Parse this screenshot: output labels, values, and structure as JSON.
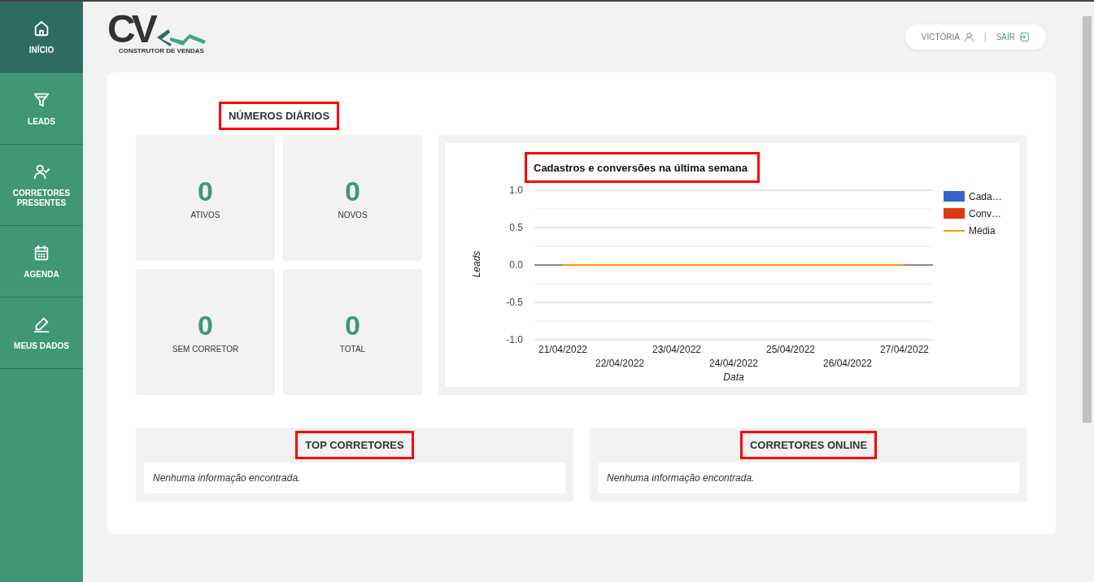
{
  "sidebar": {
    "items": [
      {
        "label": "INÍCIO",
        "selected": true
      },
      {
        "label": "LEADS",
        "selected": false
      },
      {
        "label": "CORRETORES PRESENTES",
        "selected": false
      },
      {
        "label": "AGENDA",
        "selected": false
      },
      {
        "label": "MEUS DADOS",
        "selected": false
      }
    ]
  },
  "header": {
    "logo": {
      "mark": "CV",
      "tagline": "CONSTRUTOR DE VENDAS"
    },
    "user": "VICTÓRIA",
    "separator": "|",
    "logout": "SAIR"
  },
  "daily_numbers": {
    "title": "NÚMEROS DIÁRIOS",
    "framed": true,
    "stats": [
      {
        "value": "0",
        "label": "ATIVOS"
      },
      {
        "value": "0",
        "label": "NOVOS"
      },
      {
        "value": "0",
        "label": "SEM CORRETOR"
      },
      {
        "value": "0",
        "label": "TOTAL"
      }
    ]
  },
  "weekly_chart": {
    "framed": true,
    "chart_data": {
      "type": "bar",
      "title": "Cadastros e conversões na última semana",
      "xlabel": "Data",
      "ylabel": "Leads",
      "categories": [
        "21/04/2022",
        "22/04/2022",
        "23/04/2022",
        "24/04/2022",
        "25/04/2022",
        "26/04/2022",
        "27/04/2022"
      ],
      "ylim": [
        -1,
        1
      ],
      "grid": true,
      "yticks": [
        {
          "value": 1,
          "label": "1.0"
        },
        {
          "value": 0.5,
          "label": "0.5"
        },
        {
          "value": 0,
          "label": "0.0"
        },
        {
          "value": -0.5,
          "label": "-0.5"
        },
        {
          "value": -1,
          "label": "-1.0"
        }
      ],
      "series": [
        {
          "name": "Cada…",
          "color": "#3366cc",
          "type": "bar",
          "values": [
            0,
            0,
            0,
            0,
            0,
            0,
            0
          ]
        },
        {
          "name": "Conv…",
          "color": "#dc3912",
          "type": "bar",
          "values": [
            0,
            0,
            0,
            0,
            0,
            0,
            0
          ]
        },
        {
          "name": "Média",
          "color": "#ff9900",
          "type": "line",
          "values": [
            0,
            0,
            0,
            0,
            0,
            0,
            0
          ]
        }
      ]
    }
  },
  "panels": [
    {
      "title": "TOP CORRETORES",
      "framed": true,
      "message": "Nenhuma informação encontrada."
    },
    {
      "title": "CORRETORES ONLINE",
      "framed": true,
      "message": "Nenhuma informação encontrada."
    }
  ]
}
